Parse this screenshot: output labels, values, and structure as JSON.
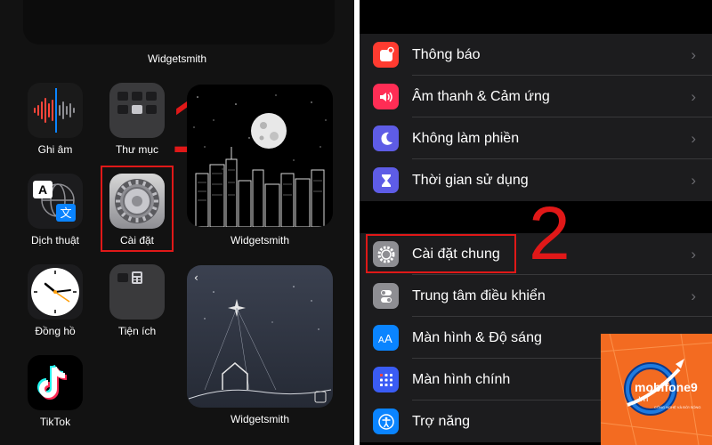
{
  "home": {
    "top_widget_label": "Widgetsmith",
    "apps": [
      {
        "name": "Ghi âm"
      },
      {
        "name": "Thư mục"
      },
      {
        "name": "Dịch thuật"
      },
      {
        "name": "Cài đặt"
      },
      {
        "name": "Đồng hồ"
      },
      {
        "name": "Tiện ích"
      },
      {
        "name": "TikTok"
      }
    ],
    "widgets": [
      {
        "label": "Widgetsmith"
      },
      {
        "label": "Widgetsmith"
      }
    ],
    "step_label": "1"
  },
  "settings": {
    "group1": [
      {
        "label": "Thông báo",
        "icon": "notification-icon",
        "color": "#ff3b30"
      },
      {
        "label": "Âm thanh & Cảm ứng",
        "icon": "speaker-icon",
        "color": "#ff2d55"
      },
      {
        "label": "Không làm phiền",
        "icon": "moon-icon",
        "color": "#5e5ce6"
      },
      {
        "label": "Thời gian sử dụng",
        "icon": "hourglass-icon",
        "color": "#5e5ce6"
      }
    ],
    "group2": [
      {
        "label": "Cài đặt chung",
        "icon": "gear-icon",
        "color": "#8e8e93"
      },
      {
        "label": "Trung tâm điều khiển",
        "icon": "toggles-icon",
        "color": "#8e8e93"
      },
      {
        "label": "Màn hình & Độ sáng",
        "icon": "text-size-icon",
        "color": "#0a84ff"
      },
      {
        "label": "Màn hình chính",
        "icon": "home-grid-icon",
        "color": "#3a5cf5"
      },
      {
        "label": "Trợ năng",
        "icon": "accessibility-icon",
        "color": "#0a84ff"
      }
    ],
    "chevron": "›",
    "step_label": "2"
  },
  "watermark": {
    "brand": "mobifone9",
    "domain": ".vn",
    "tagline": "CÔNG NGHỆ VÀ ĐỜI SỐNG",
    "color": "#f36b21"
  },
  "colors": {
    "highlight": "#e01818"
  }
}
